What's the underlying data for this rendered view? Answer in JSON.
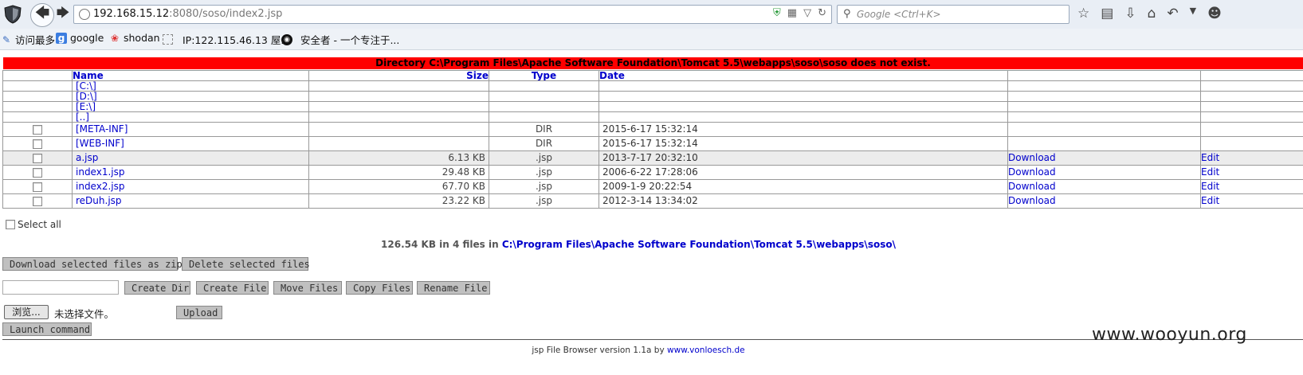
{
  "browser": {
    "url_host": "192.168.15.12",
    "url_rest": ":8080/soso/index2.jsp",
    "search_placeholder": "Google <Ctrl+K>"
  },
  "bookmarks": [
    {
      "label": "访问最多",
      "icon": "most-visited-icon"
    },
    {
      "label": "google",
      "icon": "google-icon"
    },
    {
      "label": "shodan",
      "icon": "shodan-icon"
    },
    {
      "label": "IP:122.115.46.13 屋...",
      "icon": "page-icon"
    },
    {
      "label": "安全者 - 一个专注于...",
      "icon": "github-icon"
    }
  ],
  "error": "Directory C:\\Program Files\\Apache Software Foundation\\Tomcat 5.5\\webapps\\soso\\soso does not exist.",
  "table": {
    "headers": {
      "name": "Name",
      "size": "Size",
      "type": "Type",
      "date": "Date"
    },
    "drives": [
      "[C:\\]",
      "[D:\\]",
      "[E:\\]",
      "[..]"
    ],
    "rows": [
      {
        "name": "[META-INF]",
        "size": "",
        "type": "DIR",
        "date": "2015-6-17 15:32:14",
        "download": "",
        "edit": ""
      },
      {
        "name": "[WEB-INF]",
        "size": "",
        "type": "DIR",
        "date": "2015-6-17 15:32:14",
        "download": "",
        "edit": ""
      },
      {
        "name": "a.jsp",
        "size": "6.13 KB",
        "type": ".jsp",
        "date": "2013-7-17 20:32:10",
        "download": "Download",
        "edit": "Edit"
      },
      {
        "name": "index1.jsp",
        "size": "29.48 KB",
        "type": ".jsp",
        "date": "2006-6-22 17:28:06",
        "download": "Download",
        "edit": "Edit"
      },
      {
        "name": "index2.jsp",
        "size": "67.70 KB",
        "type": ".jsp",
        "date": "2009-1-9 20:22:54",
        "download": "Download",
        "edit": "Edit"
      },
      {
        "name": "reDuh.jsp",
        "size": "23.22 KB",
        "type": ".jsp",
        "date": "2012-3-14 13:34:02",
        "download": "Download",
        "edit": "Edit"
      }
    ]
  },
  "select_all": "Select all",
  "summary": {
    "prefix": "126.54 KB in 4 files in ",
    "path": "C:\\Program Files\\Apache Software Foundation\\Tomcat 5.5\\webapps\\soso\\"
  },
  "buttons": {
    "download_zip": "Download selected files as zip",
    "delete": "Delete selected files",
    "create_dir": "Create Dir",
    "create_file": "Create File",
    "move": "Move Files",
    "copy": "Copy Files",
    "rename": "Rename File",
    "browse": "浏览...",
    "upload": "Upload",
    "launch": "Launch command"
  },
  "no_file_text": "未选择文件。",
  "footer": {
    "text": "jsp File Browser version 1.1a by ",
    "link": "www.vonloesch.de"
  },
  "watermark": "www.wooyun.org"
}
